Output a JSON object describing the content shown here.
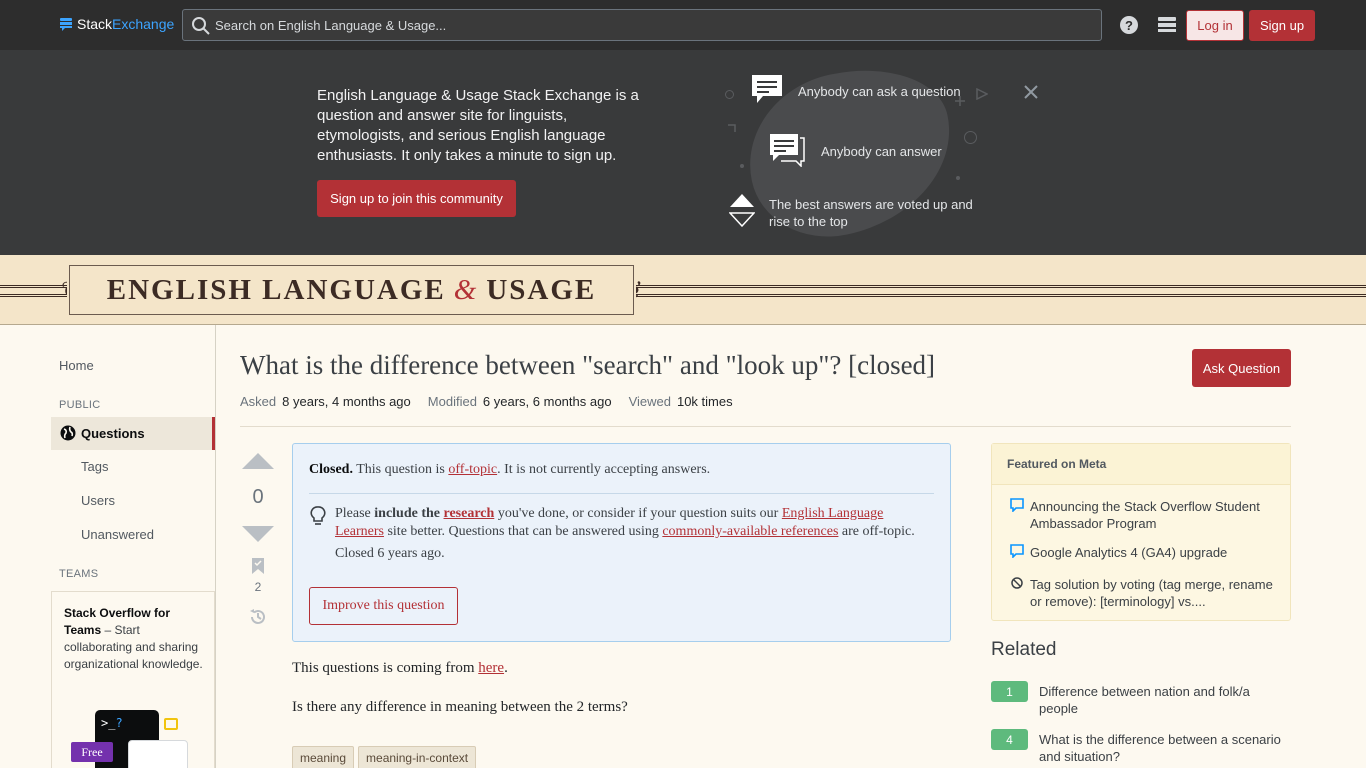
{
  "topbar": {
    "logo_stack": "Stack",
    "logo_exchange": "Exchange",
    "search_placeholder": "Search on English Language & Usage...",
    "login": "Log in",
    "signup": "Sign up"
  },
  "hero": {
    "text": "English Language & Usage Stack Exchange is a question and answer site for linguists, etymologists, and serious English language enthusiasts. It only takes a minute to sign up.",
    "button": "Sign up to join this community",
    "item1": "Anybody can ask a question",
    "item2": "Anybody can answer",
    "item3": "The best answers are voted up and rise to the top"
  },
  "banner": {
    "left": "ENGLISH LANGUAGE",
    "amp": "&",
    "right": "USAGE"
  },
  "sidebar": {
    "home": "Home",
    "public": "PUBLIC",
    "questions": "Questions",
    "tags": "Tags",
    "users": "Users",
    "unanswered": "Unanswered",
    "teams": "TEAMS",
    "teams_title": "Stack Overflow for Teams",
    "teams_desc": " – Start collaborating and sharing organizational knowledge.",
    "free": "Free"
  },
  "question": {
    "title": "What is the difference between \"search\" and \"look up\"? [closed]",
    "ask_button": "Ask Question",
    "asked_label": "Asked",
    "asked_value": "8 years, 4 months ago",
    "modified_label": "Modified",
    "modified_value": "6 years, 6 months ago",
    "viewed_label": "Viewed",
    "viewed_value": "10k times",
    "votes": "0",
    "bookmarks": "2",
    "body1_pre": "This questions is coming from ",
    "body1_link": "here",
    "body1_post": ".",
    "body2": "Is there any difference in meaning between the 2 terms?",
    "tags": [
      "meaning",
      "meaning-in-context"
    ]
  },
  "notice": {
    "closed": "Closed.",
    "text_pre": " This question is ",
    "offtopic": "off-topic",
    "text_post": ". It is not currently accepting answers.",
    "please": "Please ",
    "include": "include the ",
    "research": "research",
    "mid": " you've done, or consider if your question suits our ",
    "ell": "English Language Learners",
    "mid2": " site better. Questions that can be answered using ",
    "refs": "commonly-available references",
    "end": " are off-topic.",
    "closed_ago": "Closed 6 years ago.",
    "improve": "Improve this question"
  },
  "featured": {
    "heading": "Featured on Meta",
    "items": [
      "Announcing the Stack Overflow Student Ambassador Program",
      "Google Analytics 4 (GA4) upgrade",
      "Tag solution by voting (tag merge, rename or remove): [terminology] vs...."
    ]
  },
  "related": {
    "heading": "Related",
    "items": [
      {
        "score": "1",
        "title": "Difference between nation and folk/a people"
      },
      {
        "score": "4",
        "title": "What is the difference between a scenario and situation?"
      }
    ]
  },
  "colors": {
    "brand": "#b33136",
    "topbar": "#2d2d2d",
    "hero": "#393a3b",
    "banner": "#f4e5c9",
    "accepted": "#5eba7d"
  }
}
